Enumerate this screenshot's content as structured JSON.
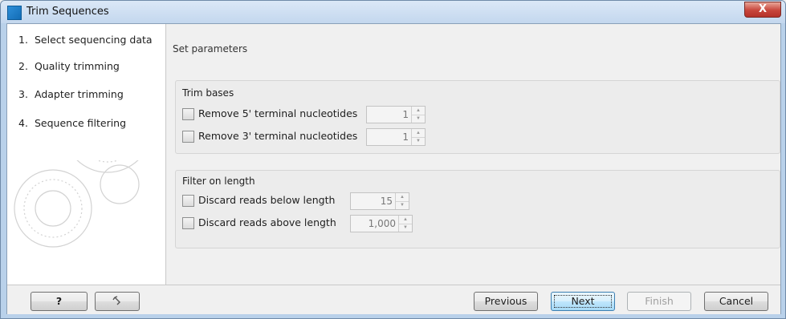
{
  "window": {
    "title": "Trim Sequences",
    "close_glyph": "X"
  },
  "steps": [
    {
      "num": "1.",
      "label": "Select sequencing data"
    },
    {
      "num": "2.",
      "label": "Quality trimming"
    },
    {
      "num": "3.",
      "label": "Adapter trimming"
    },
    {
      "num": "4.",
      "label": "Sequence filtering"
    }
  ],
  "main": {
    "section_title": "Set parameters",
    "trim_bases": {
      "label": "Trim bases",
      "rows": [
        {
          "label": "Remove 5' terminal nucleotides",
          "value": "1",
          "checked": false
        },
        {
          "label": "Remove 3' terminal nucleotides",
          "value": "1",
          "checked": false
        }
      ]
    },
    "filter_length": {
      "label": "Filter on length",
      "rows": [
        {
          "label": "Discard reads below length",
          "value": "15",
          "checked": false
        },
        {
          "label": "Discard reads above length",
          "value": "1,000",
          "checked": false
        }
      ]
    }
  },
  "buttons": {
    "help": "?",
    "reset_icon": "undo-arrow-icon",
    "previous": "Previous",
    "next": "Next",
    "finish": "Finish",
    "cancel": "Cancel"
  },
  "colors": {
    "title_bar": "#c3d7ee",
    "accent": "#126cb5",
    "close_button": "#c7453b"
  }
}
